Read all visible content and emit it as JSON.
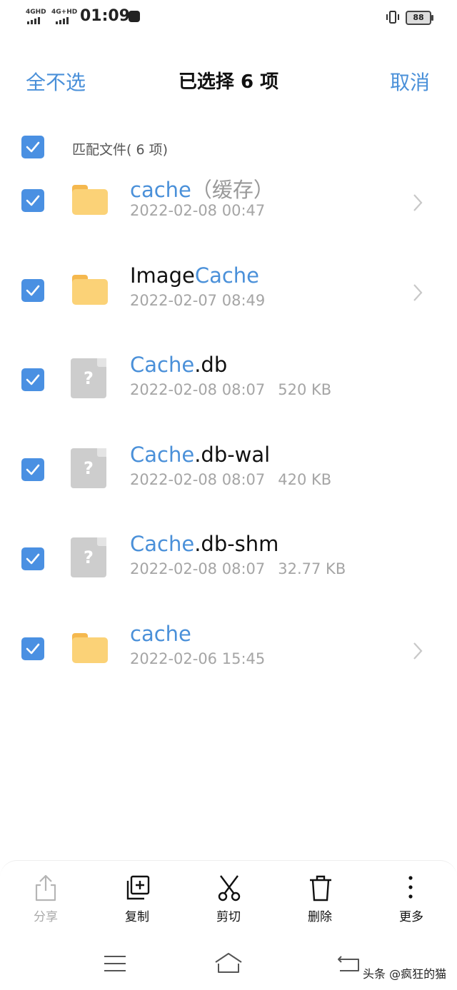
{
  "status_bar": {
    "signal_1": "4GHD",
    "signal_2": "4G+HD",
    "time": "01:09",
    "battery": "88"
  },
  "header": {
    "deselect_all": "全不选",
    "title": "已选择 6 项",
    "cancel": "取消"
  },
  "select_group": {
    "label": "匹配文件( 6 项)",
    "checked": true
  },
  "files": [
    {
      "name_highlight": "cache",
      "name_rest": "",
      "name_tag": "（缓存）",
      "date": "2022-02-08 00:47",
      "size": "",
      "type": "folder",
      "checked": true
    },
    {
      "name_highlight": "",
      "name_prefix": "Image",
      "name_rest": "Cache",
      "date": "2022-02-07 08:49",
      "size": "",
      "type": "folder",
      "checked": true
    },
    {
      "name_highlight": "Cache",
      "name_rest": ".db",
      "date": "2022-02-08 08:07",
      "size": "520 KB",
      "type": "file",
      "checked": true
    },
    {
      "name_highlight": "Cache",
      "name_rest": ".db-wal",
      "date": "2022-02-08 08:07",
      "size": "420 KB",
      "type": "file",
      "checked": true
    },
    {
      "name_highlight": "Cache",
      "name_rest": ".db-shm",
      "date": "2022-02-08 08:07",
      "size": "32.77 KB",
      "type": "file",
      "checked": true
    },
    {
      "name_highlight": "cache",
      "name_rest": "",
      "date": "2022-02-06 15:45",
      "size": "",
      "type": "folder",
      "checked": true
    }
  ],
  "toolbar": {
    "share": "分享",
    "copy": "复制",
    "cut": "剪切",
    "delete": "删除",
    "more": "更多"
  },
  "watermark": "头条 @疯狂的猫",
  "colors": {
    "accent": "#4a90d9",
    "checkbox": "#4a90e2",
    "folder": "#fbd277",
    "meta_text": "#a5a5a5"
  }
}
